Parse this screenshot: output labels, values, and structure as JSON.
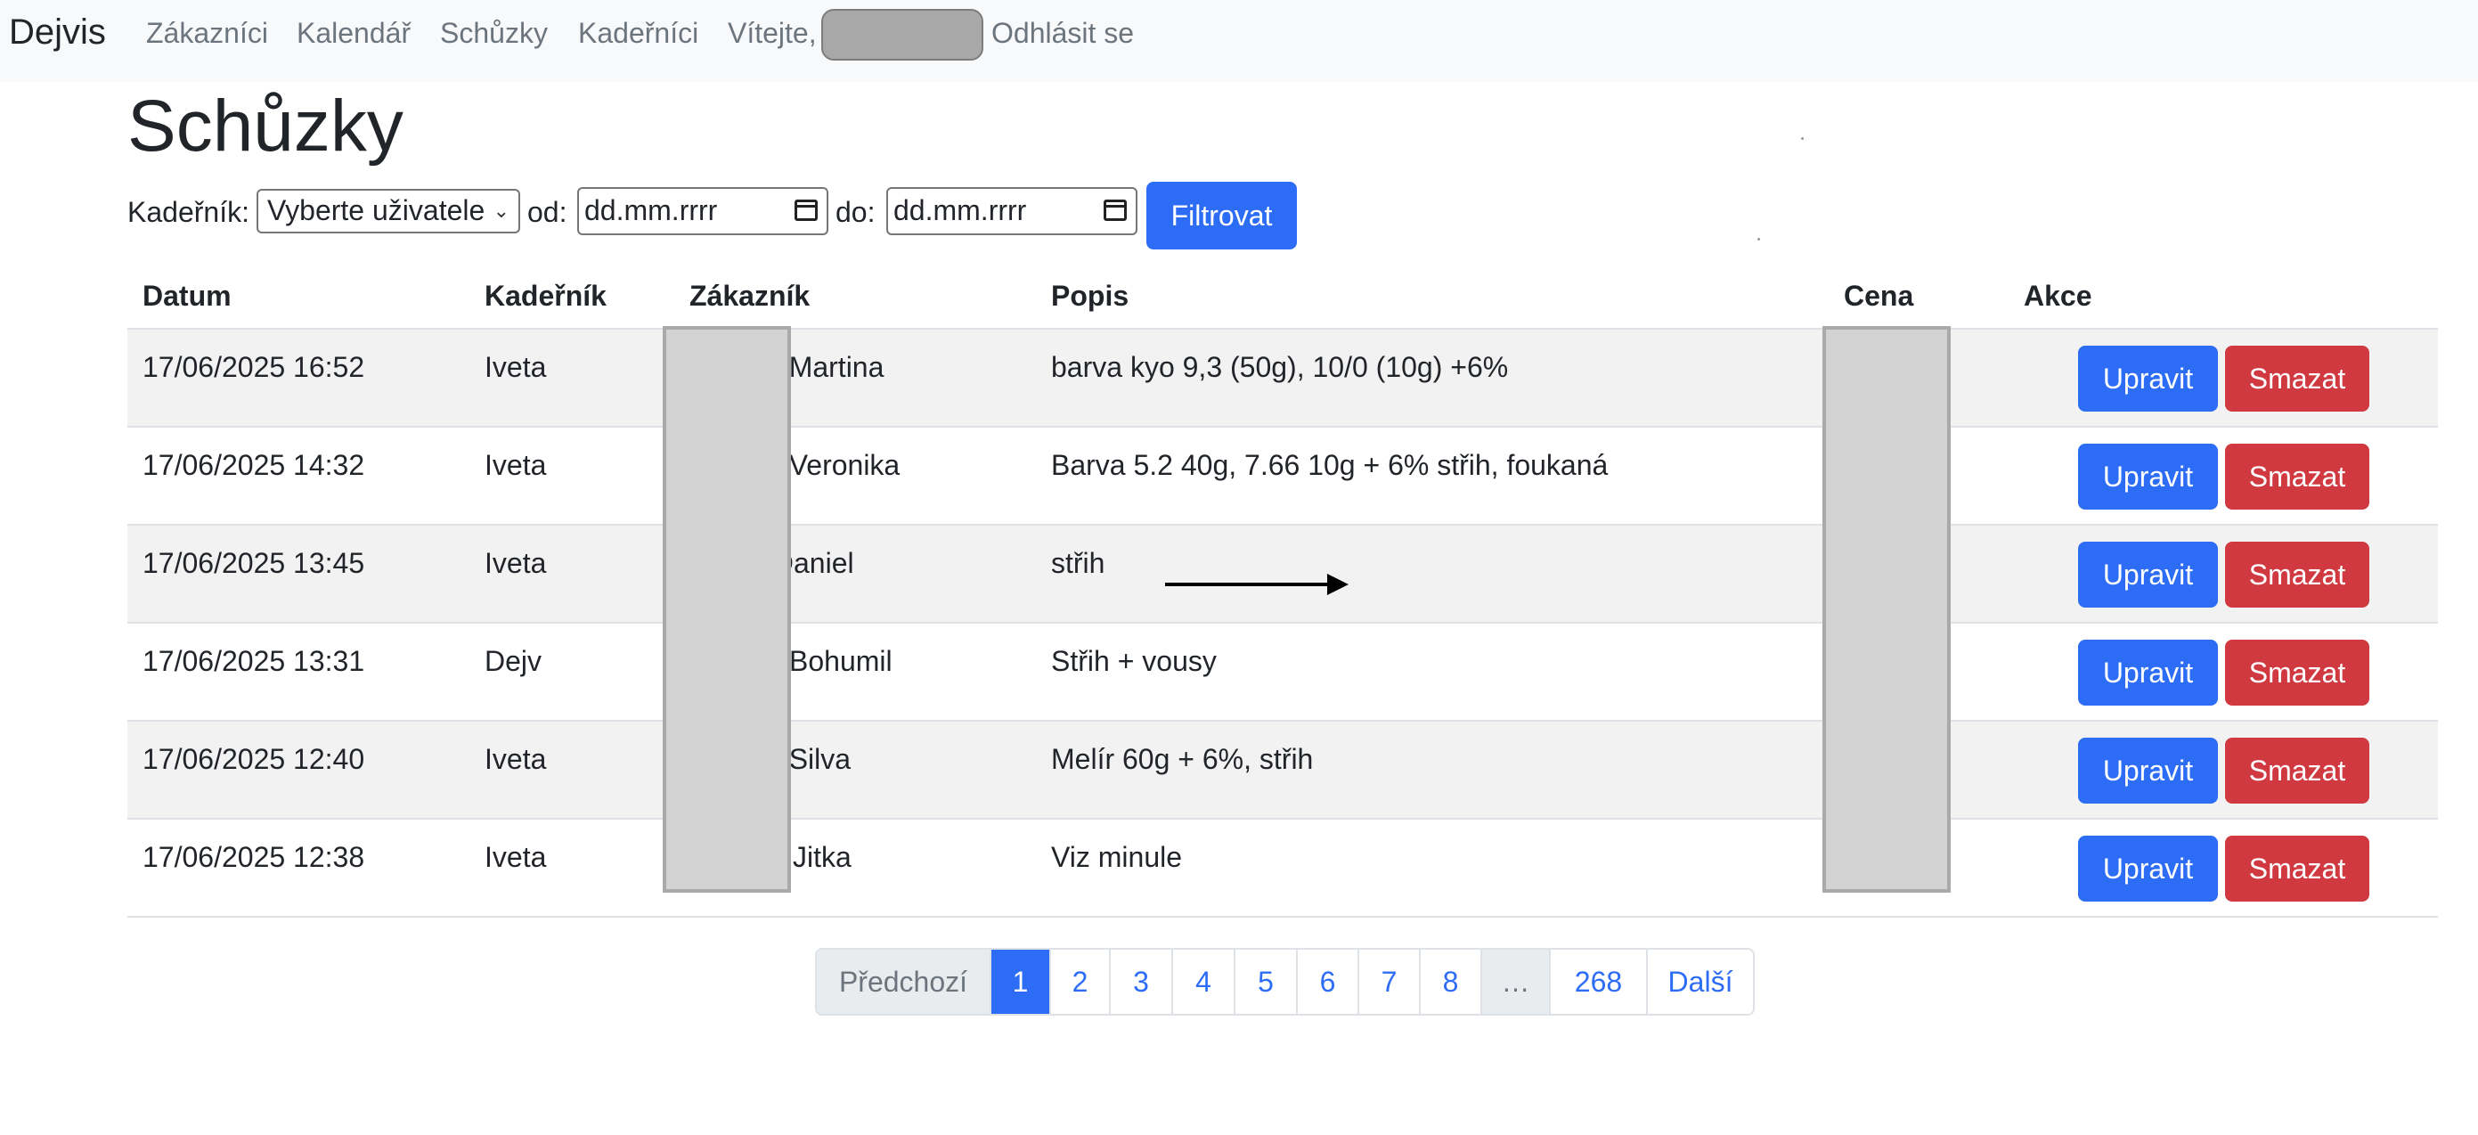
{
  "navbar": {
    "brand": "Dejvis",
    "links": [
      "Zákazníci",
      "Kalendář",
      "Schůzky",
      "Kadeřníci"
    ],
    "welcome": "Vítejte,",
    "logout": "Odhlásit se"
  },
  "page": {
    "title": "Schůzky"
  },
  "filter": {
    "hairdresser_label": "Kadeřník:",
    "hairdresser_selected": "Vyberte uživatele",
    "from_label": "od:",
    "from_value": "dd.mm.rrrr",
    "to_label": "do:",
    "to_value": "dd.mm.rrrr",
    "submit": "Filtrovat"
  },
  "table": {
    "headers": {
      "date": "Datum",
      "hairdresser": "Kadeřník",
      "customer": "Zákazník",
      "description": "Popis",
      "price": "Cena",
      "actions": "Akce"
    },
    "rows": [
      {
        "date": "17/06/2025 16:52",
        "hairdresser": "Iveta",
        "customer": "vá Martina",
        "description": "barva kyo 9,3 (50g), 10/0 (10g) +6%",
        "price": ""
      },
      {
        "date": "17/06/2025 14:32",
        "hairdresser": "Iveta",
        "customer": "vá Veronika",
        "description": "Barva 5.2 40g, 7.66 10g + 6% střih, foukaná",
        "price": ""
      },
      {
        "date": "17/06/2025 13:45",
        "hairdresser": "Iveta",
        "customer": "ý Daniel",
        "description": "střih",
        "price": ""
      },
      {
        "date": "17/06/2025 13:31",
        "hairdresser": "Dejv",
        "customer": "Bohumil",
        "description": "Střih + vousy",
        "price": ""
      },
      {
        "date": "17/06/2025 12:40",
        "hairdresser": "Iveta",
        "customer": "vá Silva",
        "description": "Melír 60g + 6%, střih",
        "price": ""
      },
      {
        "date": "17/06/2025 12:38",
        "hairdresser": "Iveta",
        "customer": "Jitka",
        "description": "Viz minule",
        "price": ""
      }
    ],
    "edit_label": "Upravit",
    "delete_label": "Smazat"
  },
  "pagination": {
    "prev": "Předchozí",
    "pages": [
      "1",
      "2",
      "3",
      "4",
      "5",
      "6",
      "7",
      "8"
    ],
    "ellipsis": "…",
    "last": "268",
    "next": "Další",
    "current": "1"
  },
  "colors": {
    "primary": "#2d6df6",
    "danger": "#d0393f",
    "navbar_bg": "#f8f9fa",
    "stripe": "#f2f2f2"
  }
}
